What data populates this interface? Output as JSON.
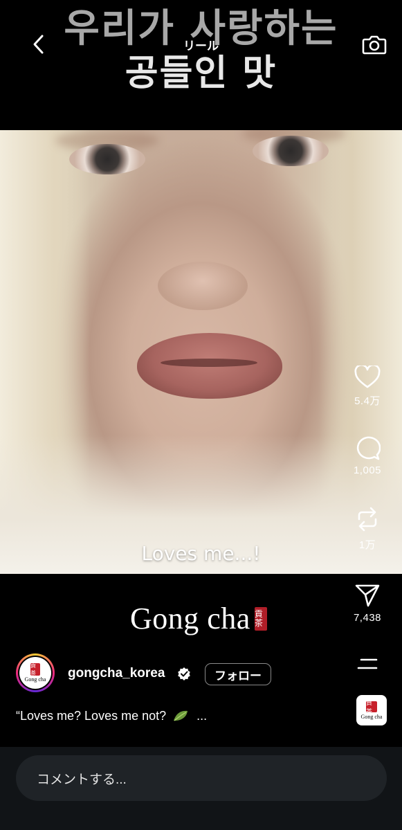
{
  "header": {
    "title": "リール",
    "title_overlay_line1": "우리가 사랑하는",
    "title_overlay_line2": "공들인 맛",
    "back_icon": "chevron-left-icon",
    "camera_icon": "camera-icon"
  },
  "video": {
    "subtitle": "Loves me...!",
    "brand_text": "Gong cha",
    "brand_seal": "貢茶"
  },
  "actions": {
    "like": {
      "icon": "heart-icon",
      "count": "5.4万"
    },
    "comment": {
      "icon": "comment-bubble-icon",
      "count": "1,005"
    },
    "repost": {
      "icon": "repost-icon",
      "count": "1万"
    },
    "share": {
      "icon": "paper-plane-icon",
      "count": "7,438"
    },
    "more_icon": "more-lines-icon",
    "audio_thumb": {
      "seal": "貢茶",
      "text": "Gong cha"
    }
  },
  "account": {
    "avatar_seal": "貢茶",
    "avatar_text": "Gong cha",
    "username": "gongcha_korea",
    "verified_icon": "verified-badge-icon",
    "follow_label": "フォロー"
  },
  "caption": {
    "text_before": "“Loves me? Loves me not?",
    "emoji_icon": "leaf-emoji-icon",
    "ellipsis": "..."
  },
  "comment_bar": {
    "placeholder": "コメントする..."
  },
  "colors": {
    "background": "#000000",
    "bottom_bar": "#111417",
    "input_bg": "#1f2327",
    "seal_red": "#c7202b"
  }
}
